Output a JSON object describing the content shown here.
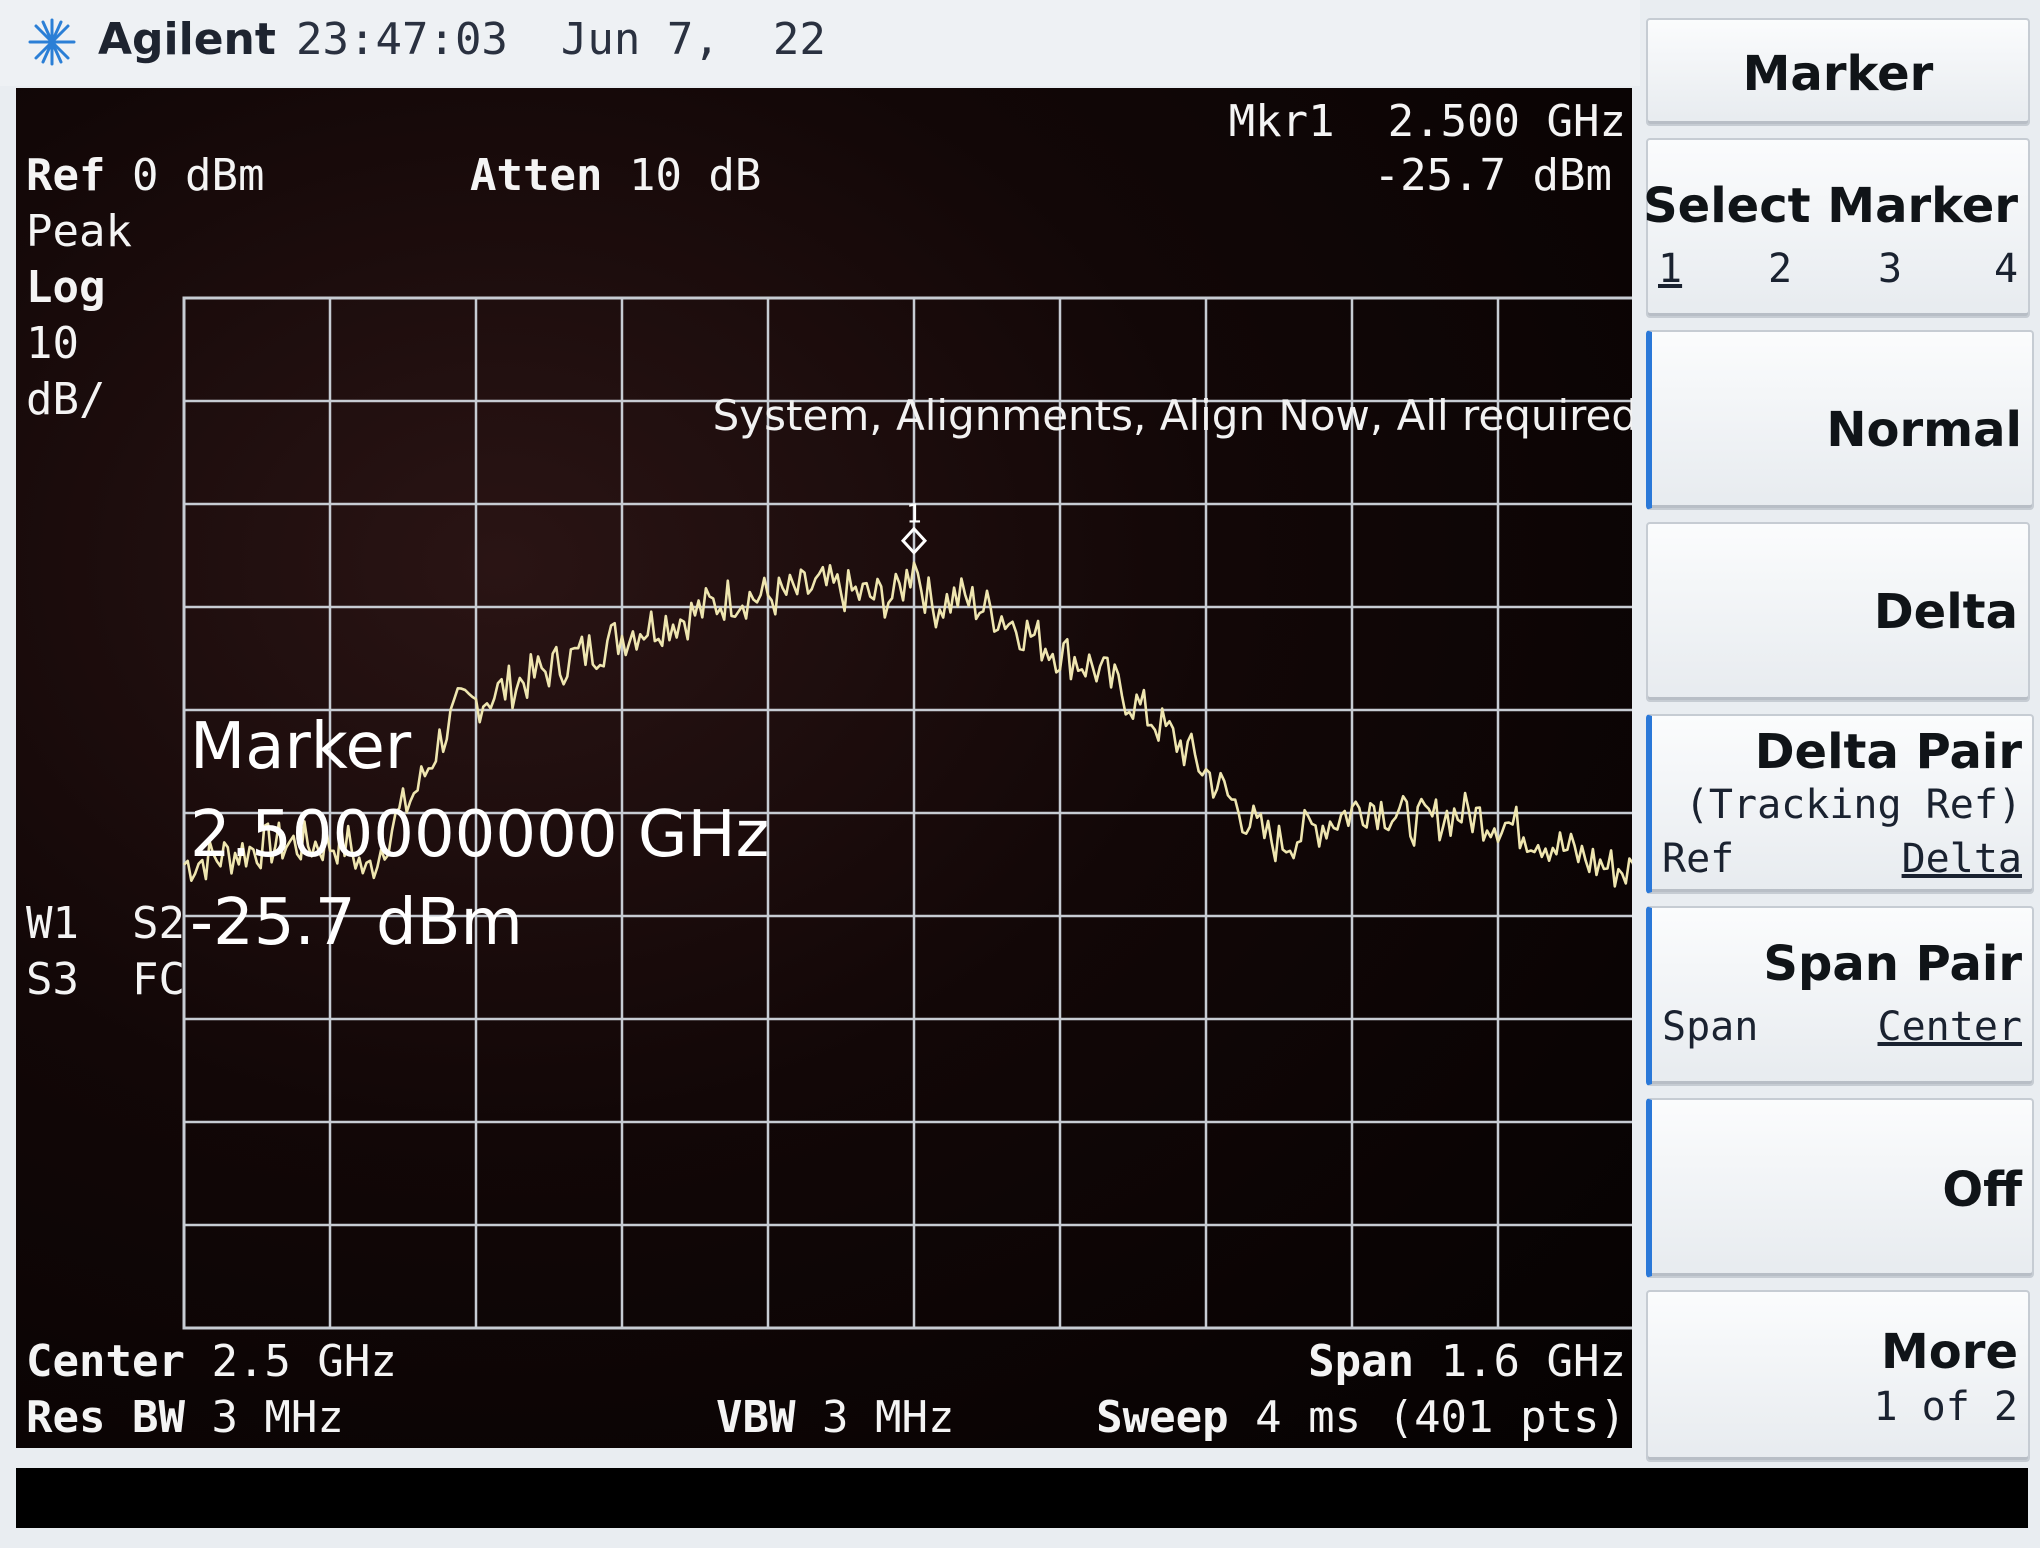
{
  "header": {
    "brand": "Agilent",
    "time": "23:47:03",
    "date": "Jun 7,  22"
  },
  "screen": {
    "ref_label": "Ref",
    "ref_value": "0 dBm",
    "atten_label": "Atten",
    "atten_value": "10 dB",
    "mkr_line1": "Mkr1  2.500 GHz",
    "mkr_line2": "-25.7 dBm",
    "detector": "Peak",
    "scale_type": "Log",
    "scale_value": "10",
    "scale_unit": "dB/",
    "alignment_msg": "System, Alignments, Align Now, All required",
    "marker_title": "Marker",
    "marker_freq": "2.500000000 GHz",
    "marker_amp": "-25.7 dBm",
    "marker_number": "1",
    "trace_status_1": "W1  S2",
    "trace_status_2": "S3  FC",
    "center_label": "Center",
    "center_value": "2.5 GHz",
    "resbw_label": "Res BW",
    "resbw_value": "3 MHz",
    "vbw_label": "VBW",
    "vbw_value": "3 MHz",
    "span_label": "Span",
    "span_value": "1.6 GHz",
    "sweep_label": "Sweep",
    "sweep_value": "4 ms (401 pts)"
  },
  "softkeys": {
    "menu_title": "Marker",
    "select_marker": "Select Marker",
    "select_options": [
      "1",
      "2",
      "3",
      "4"
    ],
    "normal": "Normal",
    "delta": "Delta",
    "delta_pair": "Delta Pair",
    "delta_pair_sub": "(Tracking Ref)",
    "delta_pair_left": "Ref",
    "delta_pair_right": "Delta",
    "span_pair": "Span Pair",
    "span_pair_left": "Span",
    "span_pair_right": "Center",
    "off": "Off",
    "more": "More",
    "more_sub": "1 of 2"
  },
  "chart_data": {
    "type": "line",
    "title": "",
    "xlabel": "",
    "ylabel": "",
    "x_center_ghz": 2.5,
    "x_span_ghz": 1.6,
    "xlim": [
      1.7,
      3.3
    ],
    "ylim": [
      -100,
      0
    ],
    "y_scale": "log 10 dB/div",
    "grid": true,
    "grid_divisions": [
      10,
      10
    ],
    "series": [
      {
        "values_note": "",
        "x": [
          1.7,
          1.75,
          1.8,
          1.85,
          1.88,
          1.9,
          1.93,
          1.96,
          1.98,
          2.0,
          2.05,
          2.1,
          2.15,
          2.2,
          2.25,
          2.3,
          2.35,
          2.4,
          2.45,
          2.48,
          2.5,
          2.52,
          2.55,
          2.6,
          2.65,
          2.7,
          2.75,
          2.8,
          2.85,
          2.88,
          2.9,
          2.95,
          3.0,
          3.05,
          3.1,
          3.15,
          3.2,
          3.25,
          3.3
        ],
        "y": [
          -55,
          -54,
          -53,
          -53,
          -53,
          -56,
          -51,
          -47,
          -43,
          -40,
          -38,
          -36,
          -34,
          -32,
          -31,
          -29,
          -29,
          -28,
          -29,
          -29,
          -26,
          -30,
          -29,
          -31,
          -34,
          -36,
          -40,
          -44,
          -49,
          -52,
          -53,
          -51,
          -49,
          -51,
          -50,
          -51,
          -53,
          -55,
          -56
        ]
      }
    ],
    "markers": [
      {
        "name": "1",
        "x": 2.5,
        "y": -25.7
      }
    ]
  }
}
